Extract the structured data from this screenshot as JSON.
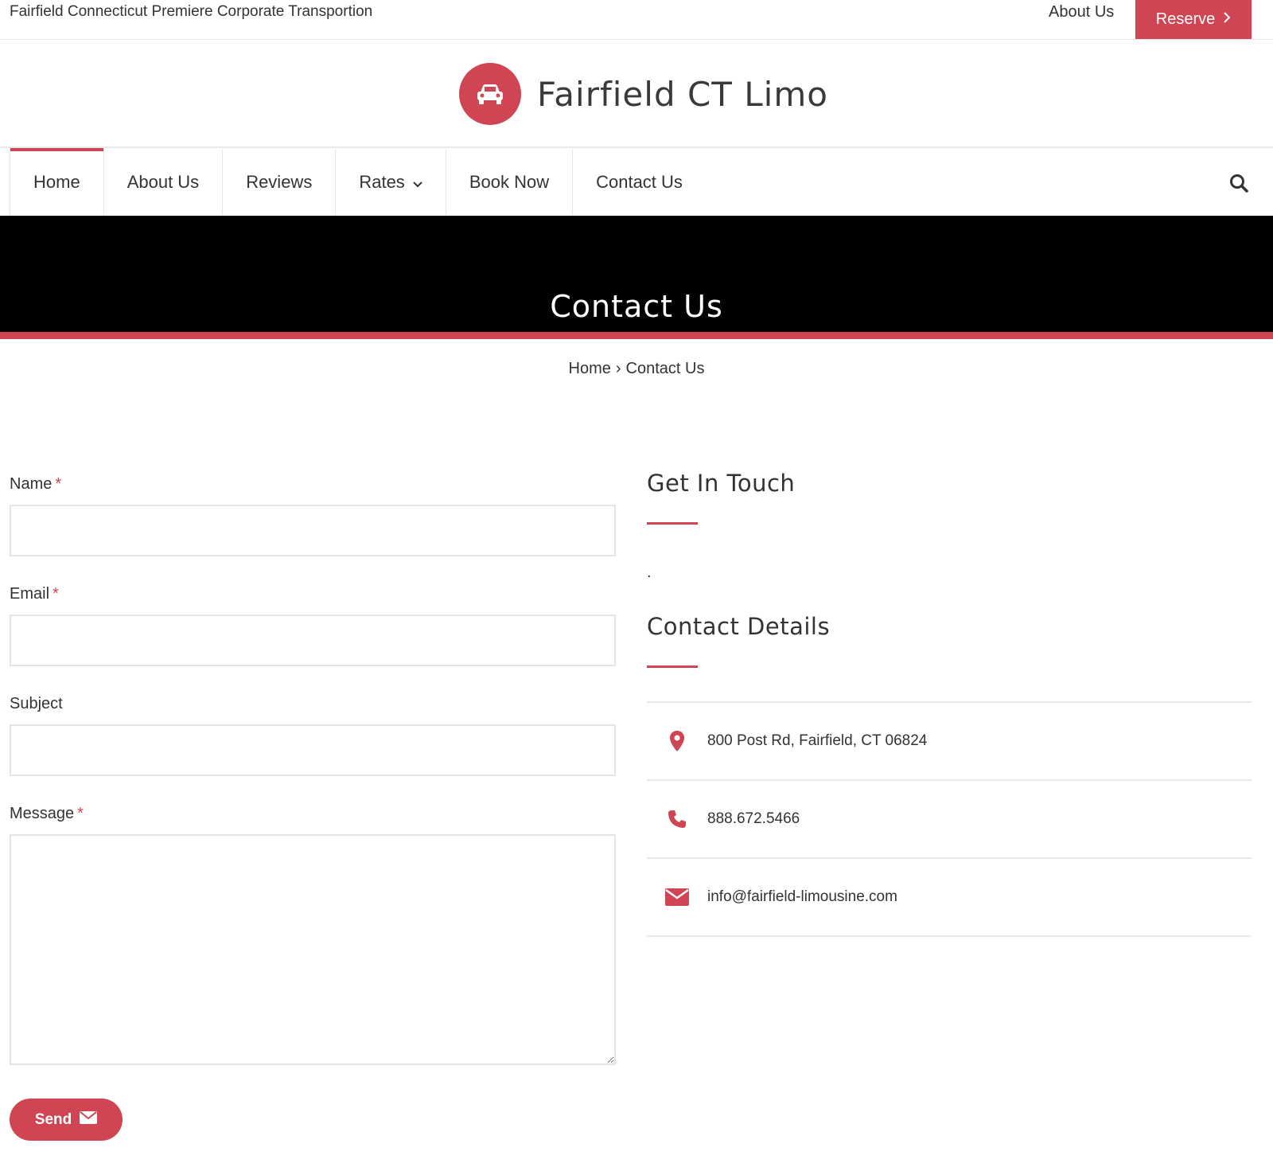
{
  "topbar": {
    "tagline": "Fairfield Connecticut Premiere Corporate Transportion",
    "about_link": "About Us",
    "reserve_label": "Reserve"
  },
  "header": {
    "site_title": "Fairfield CT Limo",
    "logo_icon": "car-icon"
  },
  "nav": {
    "items": [
      {
        "label": "Home",
        "active": true
      },
      {
        "label": "About Us"
      },
      {
        "label": "Reviews"
      },
      {
        "label": "Rates",
        "has_dropdown": true
      },
      {
        "label": "Book Now"
      },
      {
        "label": "Contact Us"
      }
    ],
    "search_icon": "search-icon"
  },
  "banner": {
    "title": "Contact Us"
  },
  "breadcrumb": {
    "home": "Home",
    "separator": "›",
    "current": "Contact Us"
  },
  "form": {
    "name_label": "Name",
    "email_label": "Email",
    "subject_label": "Subject",
    "message_label": "Message",
    "required_mark": "*",
    "send_label": "Send"
  },
  "contact": {
    "get_in_touch_heading": "Get In Touch",
    "get_in_touch_text": ".",
    "details_heading": "Contact Details",
    "address": "800 Post Rd, Fairfield, CT 06824",
    "phone": "888.672.5466",
    "email": "info@fairfield-limousine.com"
  },
  "colors": {
    "accent": "#cf4553",
    "banner_bg": "#000000",
    "text": "#333333"
  }
}
